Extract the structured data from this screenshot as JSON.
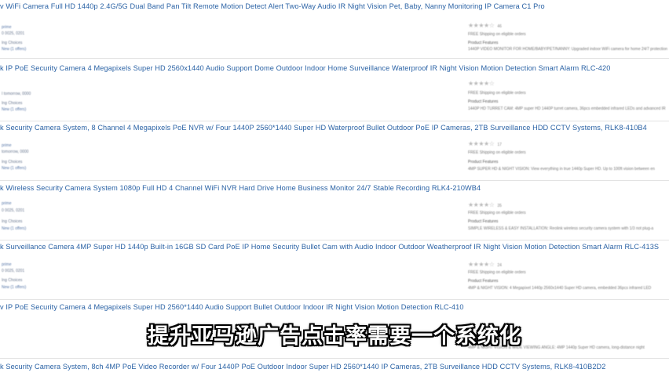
{
  "listings": [
    {
      "title": "v WiFi Camera Full HD 1440p 2.4G/5G Dual Band Pan Tilt Remote Motion Detect Alert Two-Way Audio IR Night Vision Pet, Baby, Nanny Monitoring IP Camera C1 Pro",
      "prime": "prime",
      "shipping": "0 0025, 0201",
      "choices": "Ing Choices",
      "new": "New  (1 offers)",
      "stars": "★★★★☆",
      "review_count": "46",
      "free_shipping": "FREE Shipping on eligible orders",
      "features_label": "Product Features",
      "feature": "1440P VIDEO MONITOR FOR HOME/BABY/PET/NANNY: Upgraded indoor WiFi camera for home 24/7 protection"
    },
    {
      "title": "k IP PoE Security Camera 4 Megapixels Super HD 2560x1440 Audio Support Dome Outdoor Indoor Home Surveillance Waterproof IR Night Vision Motion Detection Smart Alarm RLC-420",
      "prime": "",
      "shipping": "I tomorrow, 0000",
      "choices": "Ing Choices",
      "new": "New  (1 offers)",
      "stars": "★★★★☆",
      "review_count": "",
      "free_shipping": "FREE Shipping on eligible orders",
      "features_label": "Product Features",
      "feature": "1440P HD TURRET CAM: 4MP super HD 1440P turret camera, 36pcs embedded infrared LEDs and advanced IR"
    },
    {
      "title": "k Security Camera System, 8 Channel 4 Megapixels PoE NVR w/ Four 1440P 2560*1440 Super HD Waterproof Bullet Outdoor PoE IP Cameras, 2TB Surveillance HDD CCTV Systems, RLK8-410B4",
      "prime": "prime",
      "shipping": "tomorrow, 0000",
      "choices": "Ing Choices",
      "new": "New  (1 offers)",
      "stars": "★★★★☆",
      "review_count": "17",
      "free_shipping": "FREE Shipping on eligible orders",
      "features_label": "Product Features",
      "feature": "4MP SUPER HD & NIGHT VISION: View everything in true 1440p Super HD. Up to 100ft vision between en"
    },
    {
      "title": "k Wireless Security Camera System 1080p Full HD 4 Channel WiFi NVR Hard Drive Home Business Monitor 24/7 Stable Recording RLK4-210WB4",
      "prime": "prime",
      "shipping": "0 0025, 0201",
      "choices": "Ing Choices",
      "new": "New  (1 offers)",
      "stars": "★★★★☆",
      "review_count": "35",
      "free_shipping": "FREE Shipping on eligible orders",
      "features_label": "Product Features",
      "feature": "SIMPLE WIRELESS & EASY INSTALLATION: Reolink wireless security camera system with 1/3 not plug-a"
    },
    {
      "title": "k Surveillance Camera 4MP Super HD 1440p Built-in 16GB SD Card PoE IP Home Security Bullet Cam with Audio Indoor Outdoor Weatherproof IR Night Vision Motion Detection Smart Alarm RLC-413S",
      "prime": "prime",
      "shipping": "0 0025, 0201",
      "choices": "Ing Choices",
      "new": "New  (1 offers)",
      "stars": "★★★★☆",
      "review_count": "24",
      "free_shipping": "FREE Shipping on eligible orders",
      "features_label": "Product Features",
      "feature": "4MP & NIGHT VISION: 4 Megapixel 1440p 2560x1440 Super HD camera, embedded 36pcs infrared LED"
    },
    {
      "title": "v IP PoE Security Camera 4 Megapixels Super HD 2560*1440 Audio Support Bullet Outdoor Indoor IR Night Vision Motion Detection RLC-410",
      "prime": "",
      "shipping": "",
      "choices": "",
      "new": "",
      "stars": "",
      "review_count": "",
      "free_shipping": "",
      "features_label": "",
      "feature": "4MP & NIGHT VISION & WIDE VIEWING ANGLE: 4MP 1440p Super HD camera, long-distance night"
    },
    {
      "title": "k Security Camera System, 8ch 4MP PoE Video Recorder w/ Four 1440P PoE Outdoor Indoor Super HD 2560*1440 IP Cameras, 2TB Surveillance HDD CCTV Systems, RLK8-410B2D2",
      "prime": "",
      "shipping": "",
      "choices": "",
      "new": "",
      "stars": "",
      "review_count": "",
      "free_shipping": "",
      "features_label": "",
      "feature": ""
    }
  ],
  "subtitle": "提升亚马逊广告点击率需要一个系统化",
  "colors": {
    "title_link": "#2a62a5",
    "meta_text": "#6a7890",
    "separator": "#e3e3e3",
    "subtitle_fill": "#ffffff",
    "subtitle_outline": "#000000"
  }
}
